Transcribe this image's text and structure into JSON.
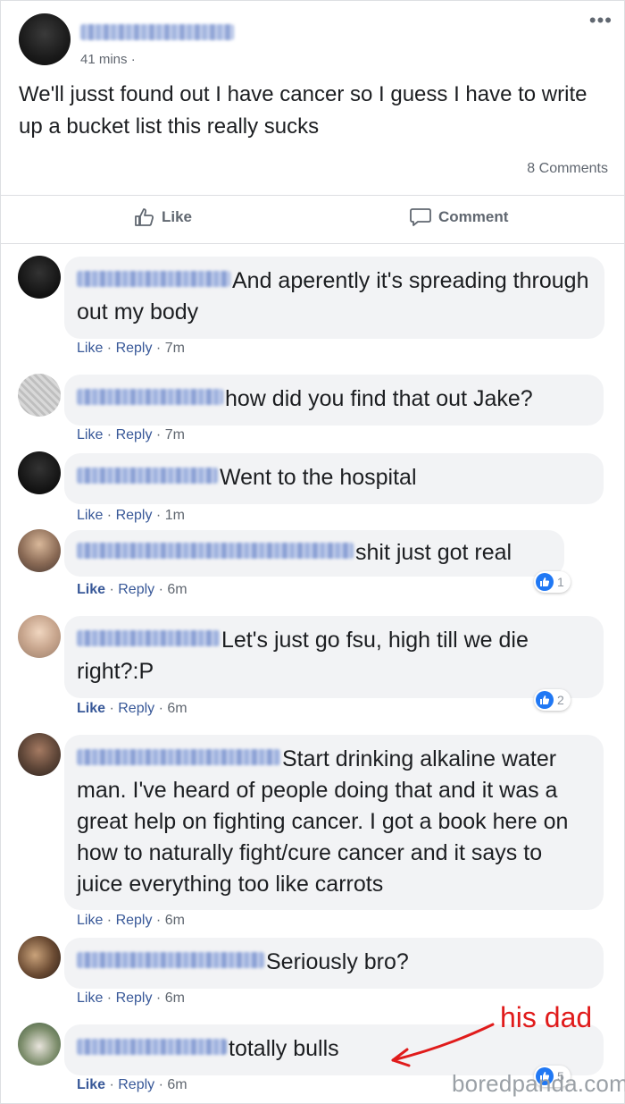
{
  "post": {
    "time": "41 mins",
    "text": "We'll jusst found out I have cancer so I guess I have to write up a bucket list this really sucks",
    "comments_count": "8 Comments",
    "more_icon": "more-dots-icon"
  },
  "actions": {
    "like_label": "Like",
    "comment_label": "Comment",
    "like_icon": "thumbs-up-icon",
    "comment_icon": "speech-bubble-icon"
  },
  "comments": [
    {
      "text": "And aperently it's spreading through out my body",
      "like": "Like",
      "reply": "Reply",
      "time": "7m",
      "reactions": ""
    },
    {
      "text": "how did you find that out Jake?",
      "like": "Like",
      "reply": "Reply",
      "time": "7m",
      "reactions": ""
    },
    {
      "text": "Went to the hospital",
      "like": "Like",
      "reply": "Reply",
      "time": "1m",
      "reactions": ""
    },
    {
      "text": "shit just got real",
      "like": "Like",
      "reply": "Reply",
      "time": "6m",
      "reactions": "1"
    },
    {
      "text": "Let's just go fsu, high till we die right?:P",
      "like": "Like",
      "reply": "Reply",
      "time": "6m",
      "reactions": "2"
    },
    {
      "text": "Start drinking alkaline water man. I've heard of people doing that and it was a great help on fighting cancer. I got a book here on how to naturally fight/cure cancer and it says to juice everything too like carrots",
      "like": "Like",
      "reply": "Reply",
      "time": "6m",
      "reactions": ""
    },
    {
      "text": "Seriously bro?",
      "like": "Like",
      "reply": "Reply",
      "time": "6m",
      "reactions": ""
    },
    {
      "text": "totally bulls",
      "like": "Like",
      "reply": "Reply",
      "time": "6m",
      "reactions": "5"
    }
  ],
  "separator": " · ",
  "annotation": {
    "text": "his dad",
    "color": "#e01b1b"
  },
  "watermark": "boredpanda.com",
  "colors": {
    "link": "#385898",
    "bubble": "#f2f3f5",
    "reaction_blue": "#2078f4"
  }
}
